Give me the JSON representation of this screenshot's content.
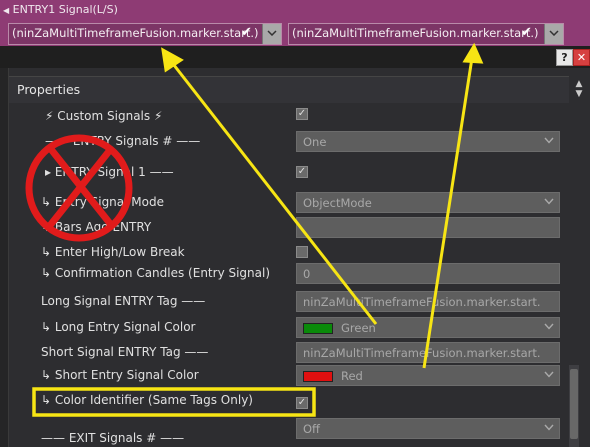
{
  "strip": {
    "title": "ENTRY1 Signal(L/S)",
    "field1": "(ninZaMultiTimeframeFusion.marker.start.)",
    "field2": "(ninZaMultiTimeframeFusion.marker.start.)"
  },
  "window": {
    "help_label": "?",
    "close_label": "✕"
  },
  "panel": {
    "title": "Properties"
  },
  "rows": [
    {
      "label": "⚡ Custom Signals ⚡",
      "value": ""
    },
    {
      "label": "—— ENTRY Signals # ——",
      "value": "One"
    },
    {
      "label": "▸ ENTRY Signal 1 ——",
      "value": ""
    },
    {
      "label": "↳ Entry Signal Mode",
      "value": "ObjectMode"
    },
    {
      "label": "↳ Bars Ago ENTRY",
      "value": ""
    },
    {
      "label": "↳ Enter High/Low Break",
      "value": ""
    },
    {
      "label": "↳ Confirmation Candles (Entry Signal)",
      "value": "0"
    },
    {
      "label": "Long Signal ENTRY Tag ——",
      "value": "ninZaMultiTimeframeFusion.marker.start."
    },
    {
      "label": "↳ Long Entry Signal Color",
      "value": "Green",
      "color": "#0a8a0a"
    },
    {
      "label": "Short Signal ENTRY Tag ——",
      "value": "ninZaMultiTimeframeFusion.marker.start."
    },
    {
      "label": "↳ Short Entry Signal Color",
      "value": "Red",
      "color": "#e01010"
    },
    {
      "label": "↳ Color Identifier (Same Tags Only)",
      "value": ""
    },
    {
      "label": "—— EXIT Signals # ——",
      "value": "Off"
    }
  ],
  "colors": {
    "highlight": "#f7e514",
    "cross": "#e11b1b"
  }
}
